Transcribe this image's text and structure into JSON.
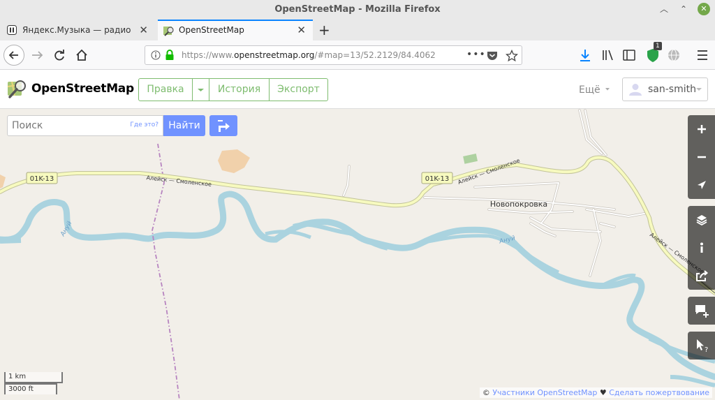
{
  "window": {
    "title": "OpenStreetMap - Mozilla Firefox"
  },
  "tabs": [
    {
      "label": "Яндекс.Музыка — радио на",
      "active": false
    },
    {
      "label": "OpenStreetMap",
      "active": true
    }
  ],
  "navbar": {
    "url_prefix": "https://www.",
    "url_domain": "openstreetmap.org",
    "url_rest": "/#map=13/52.2129/84.4062",
    "addon_badge": "1"
  },
  "osm_header": {
    "logo": "OpenStreetMap",
    "edit_label": "Правка",
    "history_label": "История",
    "export_label": "Экспорт",
    "more_label": "Ещё",
    "username": "san-smith"
  },
  "search": {
    "placeholder": "Поиск",
    "where_link": "Где это?",
    "button_label": "Найти"
  },
  "map_labels": {
    "road_ref_1": "01K-13",
    "road_ref_2": "01K-13",
    "road_name_1": "Алейск — Смоленское",
    "road_name_2": "Алейск — Смоленское",
    "road_name_3": "Алейск — Смоленское",
    "village": "Новопокровка",
    "river_1": "Ануй",
    "river_2": "Ануй"
  },
  "scale": {
    "metric": "1 km",
    "imperial": "3000 ft"
  },
  "attribution": {
    "prefix": "©",
    "contributors": "Участники OpenStreetMap",
    "heart": "♥",
    "donate": "Сделать пожертвование"
  },
  "colors": {
    "accent_green": "#7ebc6f",
    "accent_blue": "#7092ff",
    "water": "#aad3df",
    "road_yellow": "#f7fabf",
    "land": "#f2efe9"
  }
}
